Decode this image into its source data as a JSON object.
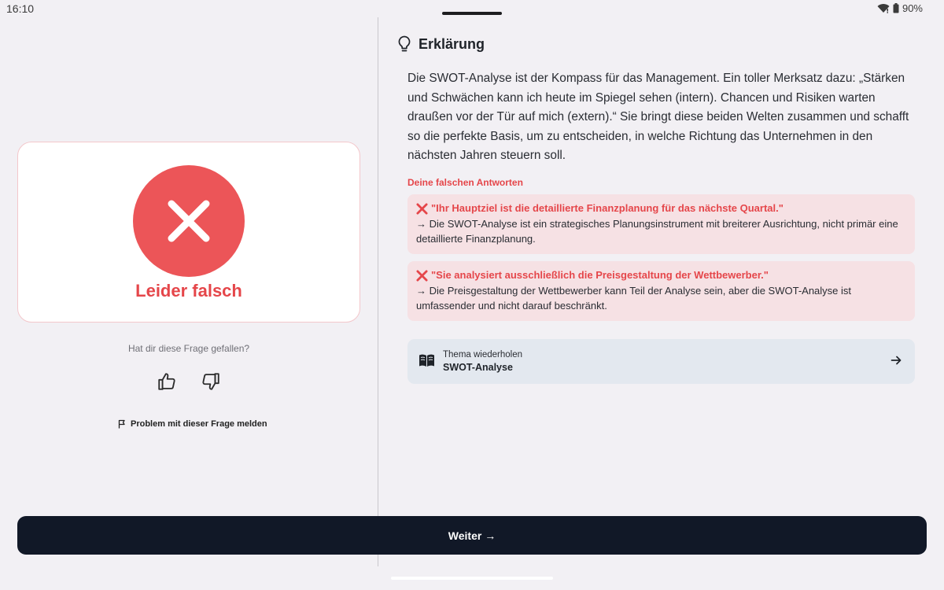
{
  "status_bar": {
    "time": "16:10",
    "battery": "90%"
  },
  "result": {
    "label": "Leider falsch"
  },
  "feedback": {
    "question": "Hat dir diese Frage gefallen?",
    "report_label": "Problem mit dieser Frage melden"
  },
  "explanation": {
    "title": "Erklärung",
    "body": "Die SWOT-Analyse ist der Kompass für das Management. Ein toller Merksatz dazu: „Stärken und Schwächen kann ich heute im Spiegel sehen (intern). Chancen und Risiken warten draußen vor der Tür auf mich (extern).“ Sie bringt diese beiden Welten zusammen und schafft so die perfekte Basis, um zu entscheiden, in welche Richtung das Unternehmen in den nächsten Jahren steuern soll."
  },
  "wrong_answers": {
    "heading": "Deine falschen Antworten",
    "items": [
      {
        "answer": "\"Ihr Hauptziel ist die detaillierte Finanzplanung für das nächste Quartal.\"",
        "reason": "→ Die SWOT-Analyse ist ein strategisches Planungsinstrument mit breiterer Ausrichtung, nicht primär eine detaillierte Finanzplanung."
      },
      {
        "answer": "\"Sie analysiert ausschließlich die Preisgestaltung der Wettbewerber.\"",
        "reason": "→ Die Preisgestaltung der Wettbewerber kann Teil der Analyse sein, aber die SWOT-Analyse ist umfassender und nicht darauf beschränkt."
      }
    ]
  },
  "topic": {
    "subtitle": "Thema wiederholen",
    "name": "SWOT-Analyse"
  },
  "next_button": {
    "label": "Weiter →"
  },
  "colors": {
    "error": "#e5464a",
    "error_circle": "#ec5558",
    "primary_button": "#111827",
    "topic_card": "#e3e8ef",
    "wrong_box": "#f6e1e4"
  },
  "icons": [
    "wifi-icon",
    "battery-icon",
    "x-mark-icon",
    "thumbs-up-icon",
    "thumbs-down-icon",
    "flag-icon",
    "lightbulb-icon",
    "cross-mark-icon",
    "book-icon",
    "arrow-right-icon"
  ]
}
